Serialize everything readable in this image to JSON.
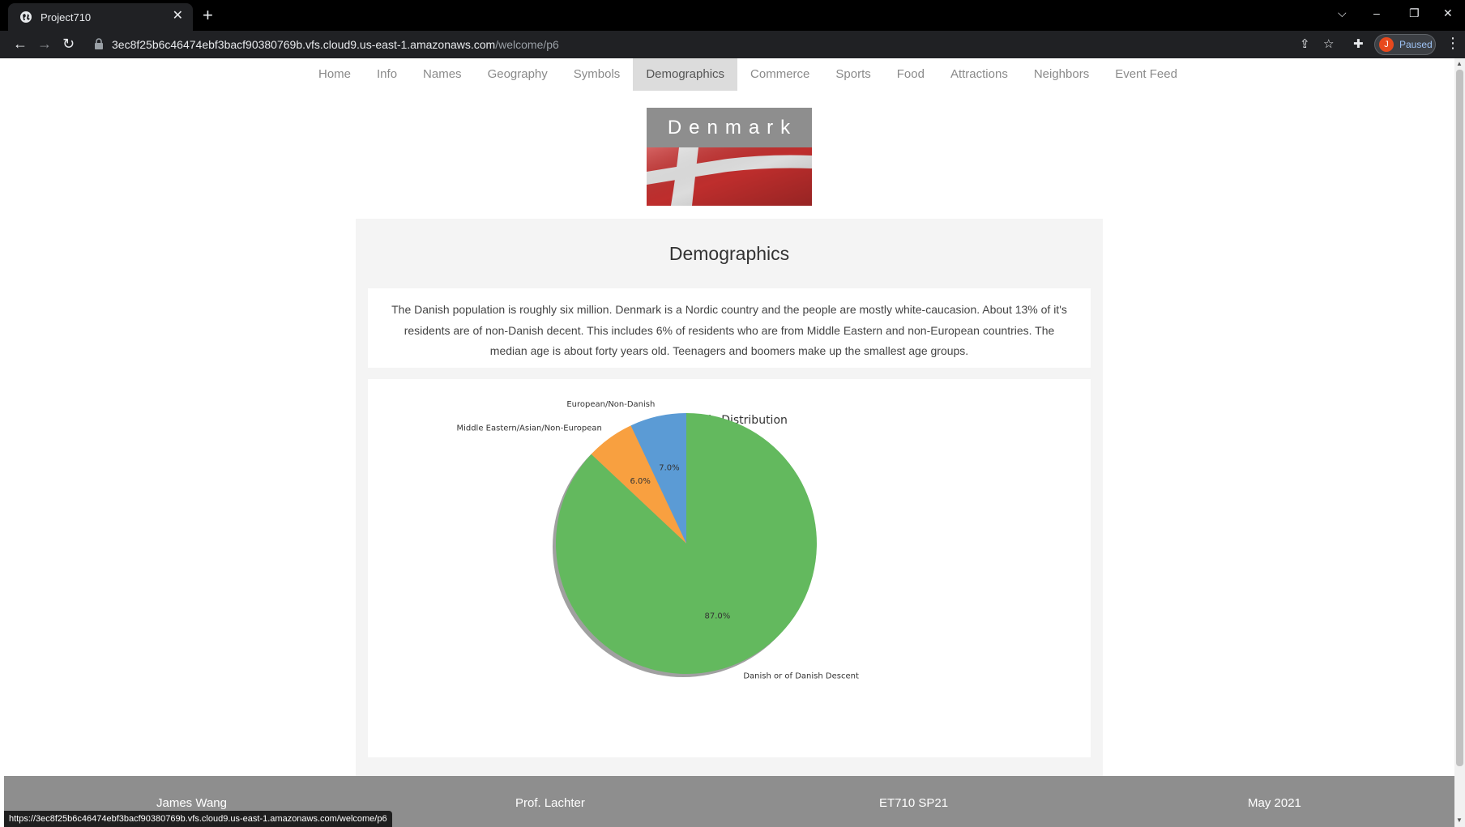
{
  "browser": {
    "tab_title": "Project710",
    "tab_close": "✕",
    "new_tab": "+",
    "url_host": "3ec8f25b6c46474ebf3bacf90380769b.vfs.cloud9.us-east-1.amazonaws.com",
    "url_path": "/welcome/p6",
    "profile_initial": "J",
    "profile_status": "Paused",
    "status_url": "https://3ec8f25b6c46474ebf3bacf90380769b.vfs.cloud9.us-east-1.amazonaws.com/welcome/p6"
  },
  "nav": {
    "items": [
      "Home",
      "Info",
      "Names",
      "Geography",
      "Symbols",
      "Demographics",
      "Commerce",
      "Sports",
      "Food",
      "Attractions",
      "Neighbors",
      "Event Feed"
    ],
    "active": "Demographics"
  },
  "header": {
    "country": "Denmark"
  },
  "section": {
    "title": "Demographics",
    "description": "The Danish population is roughly six million. Denmark is a Nordic country and the people are mostly white-caucasion. About 13% of it's residents are of non-Danish decent. This includes 6% of residents who are from Middle Eastern and non-European countries. The median age is about forty years old. Teenagers and boomers make up the smallest age groups."
  },
  "chart_data": {
    "type": "pie",
    "title": "Ethnic Distribution",
    "slices": [
      {
        "label": "European/Non-Danish",
        "value": 7.0,
        "pct_label": "7.0%",
        "color": "#5b9bd5"
      },
      {
        "label": "Middle Eastern/Asian/Non-European",
        "value": 6.0,
        "pct_label": "6.0%",
        "color": "#f8a040"
      },
      {
        "label": "Danish or of Danish Descent",
        "value": 87.0,
        "pct_label": "87.0%",
        "color": "#63b95e"
      }
    ]
  },
  "footer": {
    "items": [
      "James Wang",
      "Prof. Lachter",
      "ET710 SP21",
      "May 2021"
    ]
  }
}
